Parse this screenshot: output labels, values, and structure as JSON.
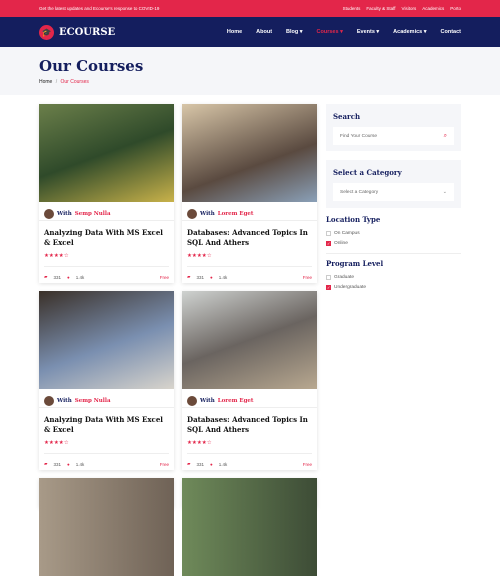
{
  "topbar": {
    "notice": "Get the latest updates and Ecourse's response to COVID-19",
    "links": [
      "Students",
      "Faculty & Staff",
      "Visitors",
      "Academics",
      "Porto"
    ]
  },
  "nav": {
    "logo": "ECOURSE",
    "items": [
      "Home",
      "About",
      "Blog ▾",
      "Courses ▾",
      "Events ▾",
      "Academics ▾",
      "Contact"
    ],
    "active": "Courses"
  },
  "hero": {
    "title": "Our Courses",
    "breadcrumb": [
      "Home",
      "/",
      "Our Courses"
    ]
  },
  "courses": [
    {
      "with": "With",
      "author": "Semp Nulla",
      "title": "Analyzing Data With MS Excel & Excel",
      "stars": "★★★★☆",
      "students": "331",
      "comments": "1.4k",
      "price": "Free"
    },
    {
      "with": "With",
      "author": "Lorem Eget",
      "title": "Databases: Advanced Topics In SQL And Athers",
      "stars": "★★★★☆",
      "students": "331",
      "comments": "1.4k",
      "price": "Free"
    },
    {
      "with": "With",
      "author": "Semp Nulla",
      "title": "Analyzing Data With MS Excel & Excel",
      "stars": "★★★★☆",
      "students": "331",
      "comments": "1.4k",
      "price": "Free"
    },
    {
      "with": "With",
      "author": "Lorem Eget",
      "title": "Databases: Advanced Topics In SQL And Athers",
      "stars": "★★★★☆",
      "students": "331",
      "comments": "1.4k",
      "price": "Free"
    }
  ],
  "sidebar": {
    "search_title": "Search",
    "search_placeholder": "Find Your Course",
    "category_title": "Select a Category",
    "category_value": "Select a Category",
    "location_title": "Location Type",
    "location": [
      {
        "label": "On Campus",
        "checked": false
      },
      {
        "label": "Online",
        "checked": true
      }
    ],
    "level_title": "Program Level",
    "level": [
      {
        "label": "Graduate",
        "checked": false
      },
      {
        "label": "Undergraduate",
        "checked": true
      }
    ]
  },
  "colors": {
    "accent": "#e3264a",
    "navy": "#141e5e"
  }
}
